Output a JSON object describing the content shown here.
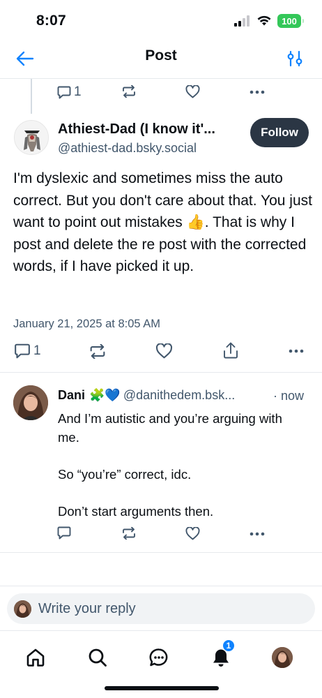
{
  "status_bar": {
    "time": "8:07",
    "battery": "100"
  },
  "header": {
    "title": "Post",
    "back_icon": "arrow-left-icon",
    "filter_icon": "sliders-icon"
  },
  "parent_actions": {
    "reply_count": "1"
  },
  "post": {
    "author_name": "Athiest-Dad (I know it'...",
    "author_handle": "@athiest-dad.bsky.social",
    "follow_label": "Follow",
    "text": "I'm dyslexic and sometimes miss the auto correct. But you don't care about that. You just want to point out mistakes 👍. That is why I post and delete the re post with the corrected words, if I have picked it up.",
    "date": "January 21, 2025 at 8:05 AM",
    "reply_count": "1"
  },
  "reply": {
    "name": "Dani",
    "emoji": "🧩💙",
    "handle": "@danithedem.bsk...",
    "time": "· now",
    "paragraphs": [
      "And I’m autistic and you’re arguing with me.",
      "So “you’re” correct, idc.",
      "Don’t start arguments then."
    ]
  },
  "composer": {
    "placeholder": "Write your reply"
  },
  "bottom_nav": {
    "notifications_badge": "1"
  },
  "colors": {
    "accent": "#1083fe",
    "muted": "#42576c",
    "follow_bg": "#2b3644",
    "battery": "#34c759"
  }
}
